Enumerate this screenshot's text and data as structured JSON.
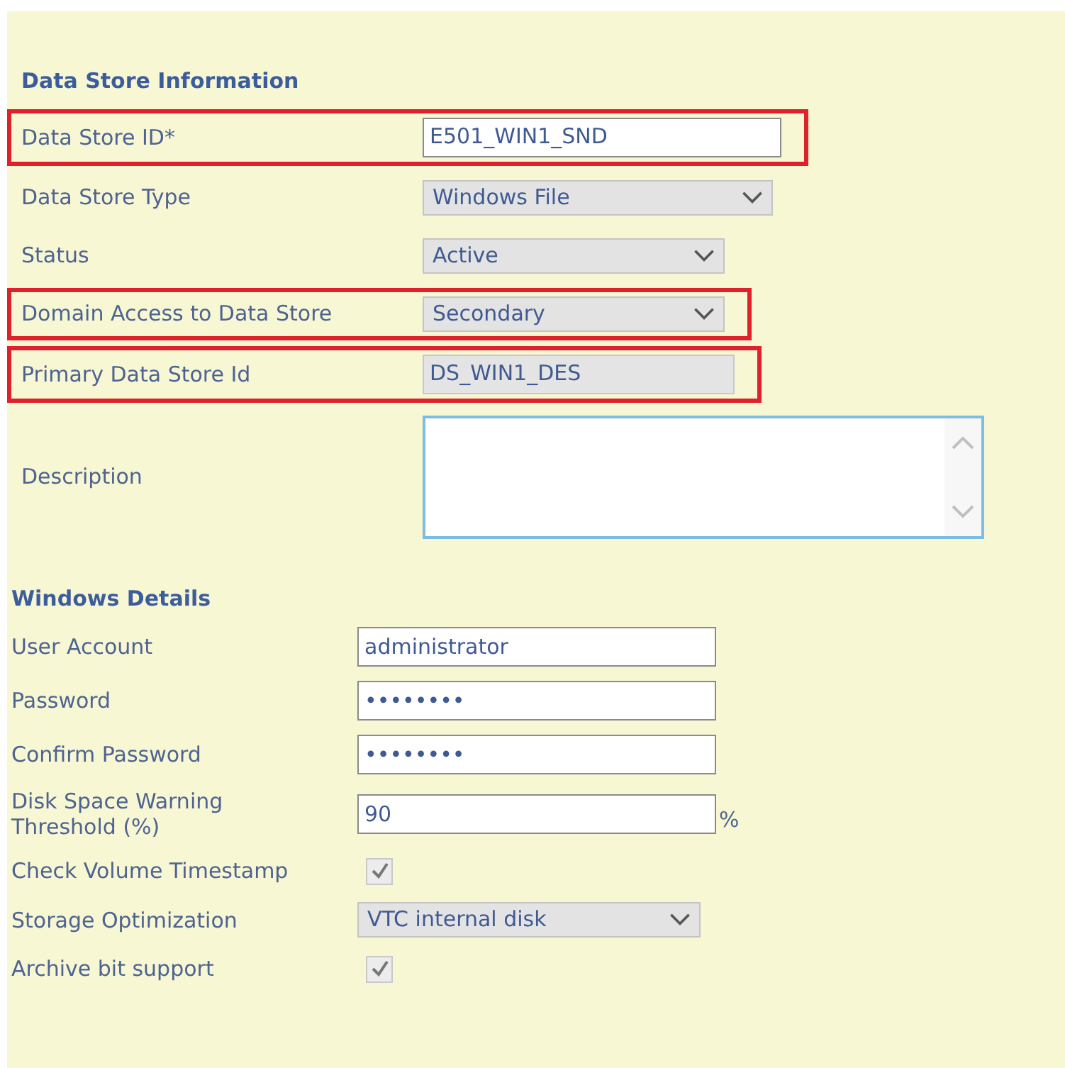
{
  "sections": [
    {
      "title": "Data Store Information",
      "fields": [
        {
          "label": "Data Store ID*",
          "kind": "text",
          "value": "E501_WIN1_SND",
          "highlighted": true
        },
        {
          "label": "Data Store Type",
          "kind": "select",
          "value": "Windows File",
          "highlighted": false
        },
        {
          "label": "Status",
          "kind": "select",
          "value": "Active",
          "highlighted": false
        },
        {
          "label": "Domain Access to Data Store",
          "kind": "select",
          "value": "Secondary",
          "highlighted": true
        },
        {
          "label": "Primary Data Store Id",
          "kind": "readonly",
          "value": "DS_WIN1_DES",
          "highlighted": true
        },
        {
          "label": "Description",
          "kind": "textarea",
          "highlighted": false
        }
      ]
    },
    {
      "title": "Windows Details",
      "fields": [
        {
          "label": "User Account",
          "kind": "text",
          "value": "administrator",
          "highlighted": false
        },
        {
          "label": "Password",
          "kind": "password",
          "value": "••••••••",
          "highlighted": false
        },
        {
          "label": "Confirm Password",
          "kind": "password",
          "value": "••••••••",
          "highlighted": false
        },
        {
          "label": "Disk Space Warning Threshold (%)",
          "kind": "text",
          "value": "90",
          "suffix": "%",
          "highlighted": false
        },
        {
          "label": "Check Volume Timestamp",
          "kind": "checkbox",
          "checked": true,
          "highlighted": false
        },
        {
          "label": "Storage Optimization",
          "kind": "select",
          "value": "VTC internal disk",
          "highlighted": false
        },
        {
          "label": "Archive bit support",
          "kind": "checkbox",
          "checked": true,
          "highlighted": false
        }
      ]
    }
  ]
}
